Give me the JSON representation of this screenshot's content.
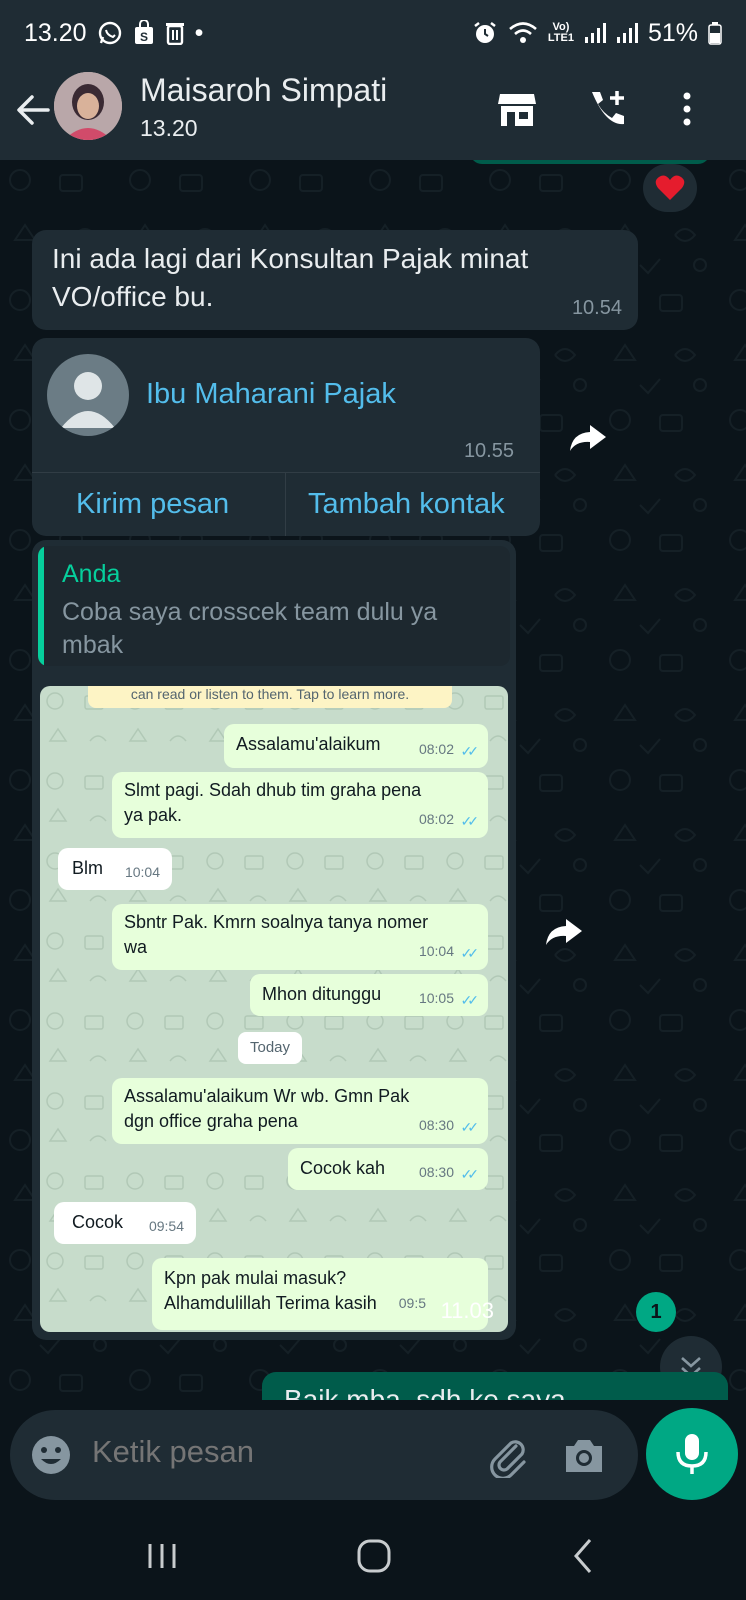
{
  "status_bar": {
    "time": "13.20",
    "dot": "•",
    "volte": "Vo)",
    "lte": "LTE1",
    "battery": "51%"
  },
  "header": {
    "contact_name": "Maisaroh Simpati",
    "subtitle": "13.20"
  },
  "chat": {
    "reaction": "heart",
    "message_1": {
      "text_line1": "Ini ada lagi dari Konsultan Pajak minat",
      "text_line2": "VO/office bu.",
      "time": "10.54"
    },
    "contact_card": {
      "name": "Ibu Maharani Pajak",
      "time": "10.55",
      "btn_send": "Kirim pesan",
      "btn_add": "Tambah kontak"
    },
    "quoted_message": {
      "author": "Anda",
      "text_line1": "Coba saya crosscek team dulu ya",
      "text_line2": "mbak"
    },
    "image_message_time": "11.03",
    "partial_outgoing": "Baik mba, sdh ke saya",
    "unread_count": "1"
  },
  "screenshot": {
    "banner": "can read or listen to them. Tap to learn more.",
    "messages": [
      {
        "dir": "out",
        "lines": [
          "Assalamu'alaikum"
        ],
        "time": "08:02"
      },
      {
        "dir": "out",
        "lines": [
          "Slmt pagi. Sdah dhub tim graha pena",
          "ya pak."
        ],
        "time": "08:02"
      },
      {
        "dir": "in",
        "lines": [
          "Blm"
        ],
        "time": "10:04"
      },
      {
        "dir": "out",
        "lines": [
          "Sbntr Pak. Kmrn soalnya tanya nomer",
          "wa"
        ],
        "time": "10:04"
      },
      {
        "dir": "out",
        "lines": [
          "Mhon ditunggu"
        ],
        "time": "10:05"
      },
      {
        "dir": "out",
        "lines": [
          "Assalamu'alaikum Wr wb. Gmn Pak",
          "dgn office graha pena"
        ],
        "time": "08:30"
      },
      {
        "dir": "out",
        "lines": [
          "Cocok kah"
        ],
        "time": "08:30"
      },
      {
        "dir": "in",
        "lines": [
          "Cocok"
        ],
        "time": "09:54"
      },
      {
        "dir": "out",
        "lines": [
          "Kpn pak mulai masuk?",
          "Alhamdulillah Terima kasih"
        ],
        "time": "09:5"
      }
    ],
    "date_chip": "Today"
  },
  "input": {
    "placeholder": "Ketik pesan"
  },
  "colors": {
    "accent": "#00a884",
    "link": "#53bdeb",
    "bubble_in": "#1f2c34",
    "background": "#0b141a"
  }
}
